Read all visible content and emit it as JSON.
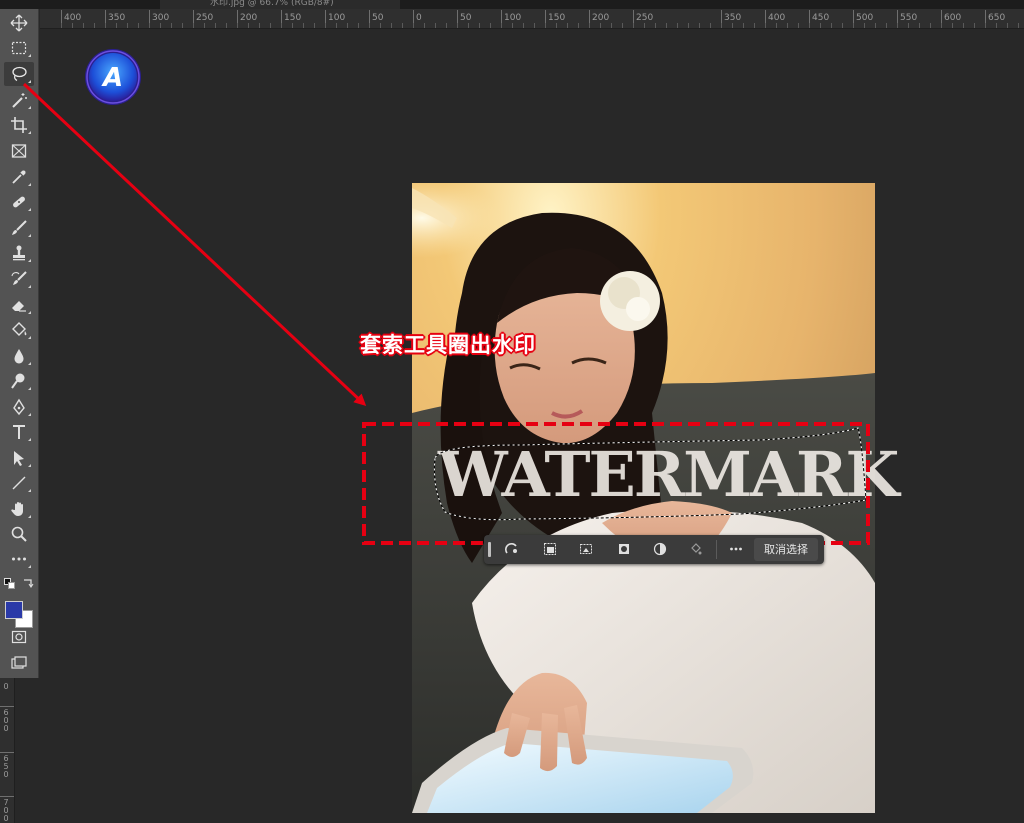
{
  "document": {
    "tab_title": "水印.jpg @ 66.7% (RGB/8#)"
  },
  "ruler": {
    "horizontal": [
      "400",
      "350",
      "300",
      "250",
      "200",
      "150",
      "100",
      "50",
      "0",
      "50",
      "100",
      "150",
      "200",
      "250",
      "350",
      "400",
      "450",
      "500",
      "550",
      "600",
      "650"
    ],
    "vertical": [
      "0",
      "600",
      "650",
      "700"
    ]
  },
  "tools": [
    {
      "name": "move-tool",
      "icon": "move-icon"
    },
    {
      "name": "marquee-tool",
      "icon": "marquee-icon"
    },
    {
      "name": "lasso-tool",
      "icon": "lasso-icon",
      "active": true
    },
    {
      "name": "magic-wand-tool",
      "icon": "magic-wand-icon"
    },
    {
      "name": "crop-tool",
      "icon": "crop-icon"
    },
    {
      "name": "frame-tool",
      "icon": "frame-icon"
    },
    {
      "name": "eyedropper-tool",
      "icon": "eyedropper-icon"
    },
    {
      "name": "healing-brush-tool",
      "icon": "bandage-icon"
    },
    {
      "name": "brush-tool",
      "icon": "brush-icon"
    },
    {
      "name": "clone-stamp-tool",
      "icon": "stamp-icon"
    },
    {
      "name": "history-brush-tool",
      "icon": "history-brush-icon"
    },
    {
      "name": "eraser-tool",
      "icon": "eraser-icon"
    },
    {
      "name": "paint-bucket-tool",
      "icon": "paint-bucket-icon"
    },
    {
      "name": "blur-tool",
      "icon": "drop-icon"
    },
    {
      "name": "dodge-tool",
      "icon": "dodge-icon"
    },
    {
      "name": "pen-tool",
      "icon": "pen-icon"
    },
    {
      "name": "type-tool",
      "icon": "type-icon"
    },
    {
      "name": "path-selection-tool",
      "icon": "arrow-icon"
    },
    {
      "name": "line-tool",
      "icon": "line-icon"
    },
    {
      "name": "hand-tool",
      "icon": "hand-icon"
    },
    {
      "name": "zoom-tool",
      "icon": "zoom-icon"
    },
    {
      "name": "more-tools",
      "icon": "ellipsis-icon"
    }
  ],
  "colors": {
    "foreground": "#2b3aa8",
    "background": "#ffffff",
    "annotation": "#e60012"
  },
  "logo": {
    "letter": "A"
  },
  "canvas": {
    "watermark_text": "WATERMARK",
    "annotation_label": "套索工具圈出水印"
  },
  "taskbar": {
    "buttons": [
      "generative-fill-icon",
      "select-subject-icon",
      "transform-selection-icon",
      "mask-icon",
      "adjustment-icon",
      "fill-icon",
      "more-icon"
    ],
    "deselect_label": "取消选择"
  }
}
